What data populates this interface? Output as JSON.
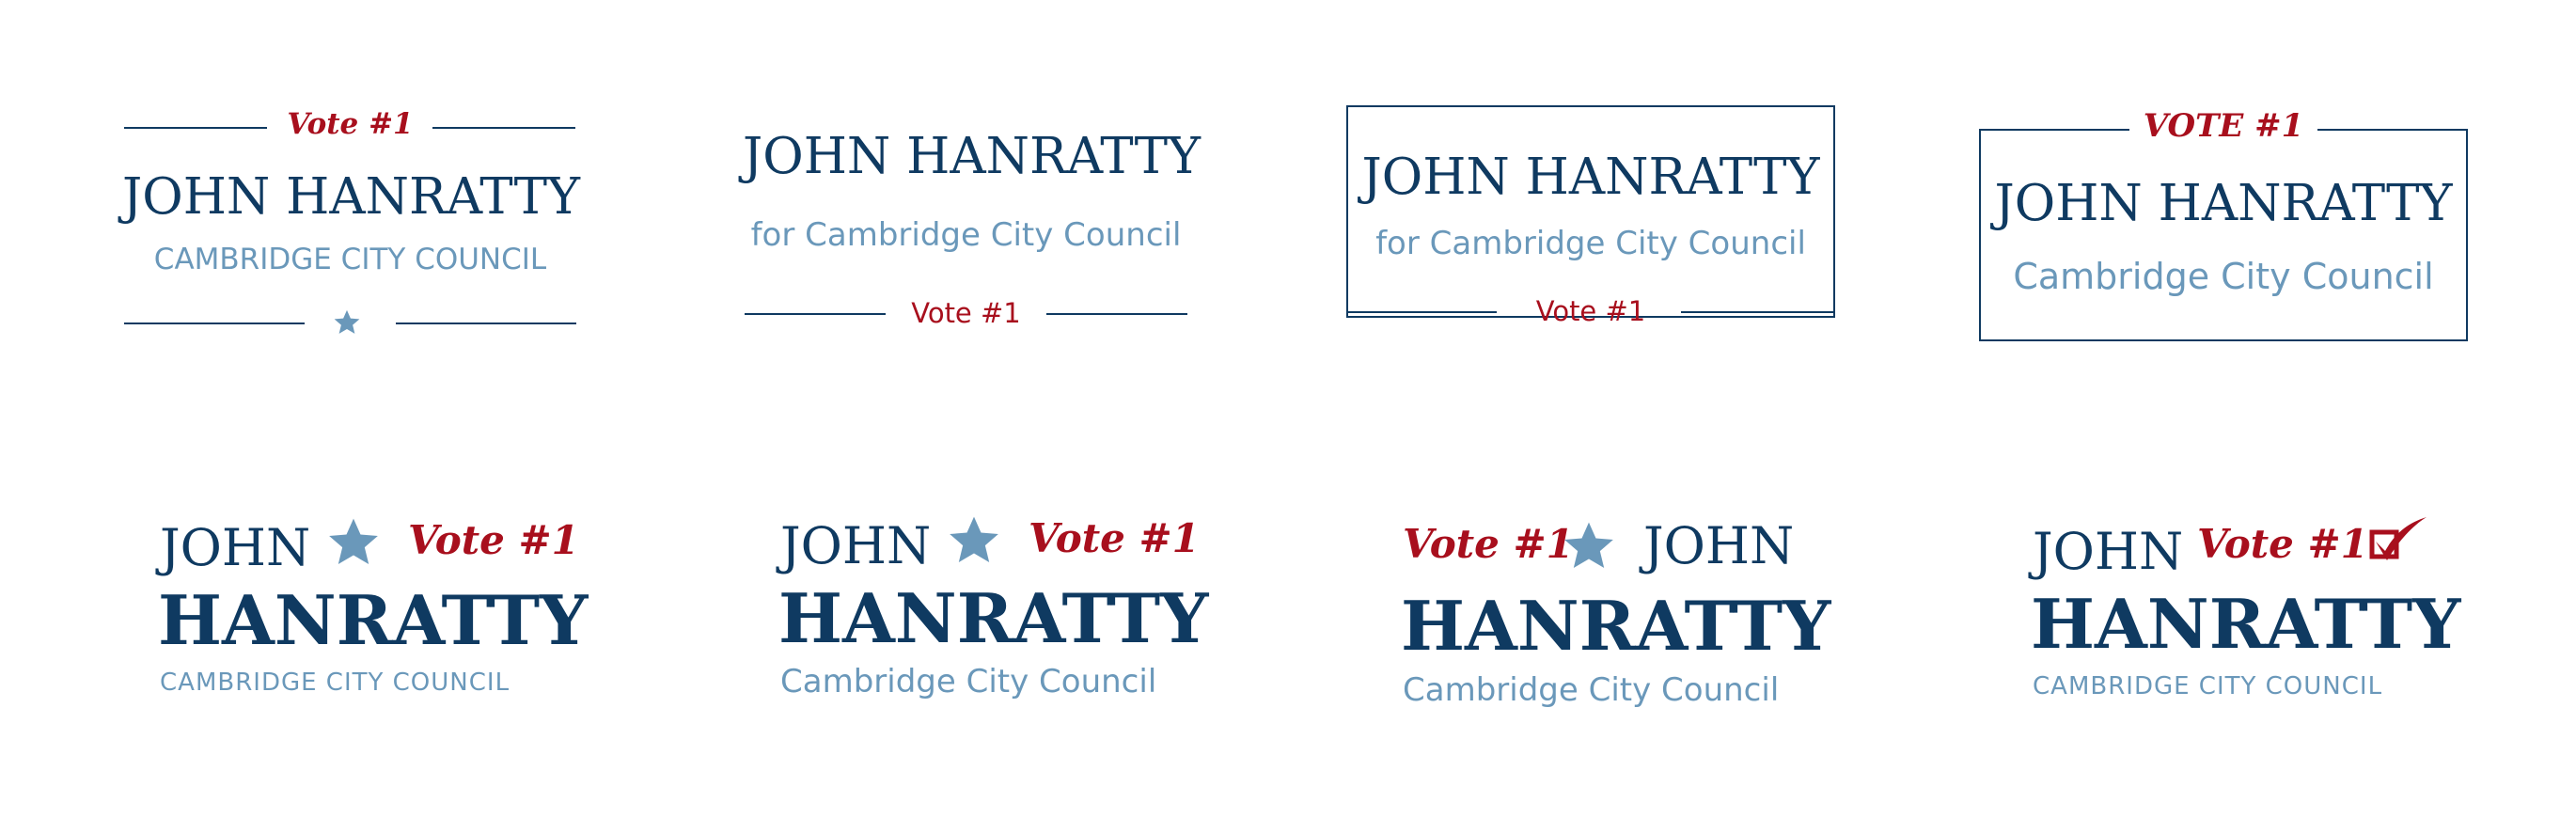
{
  "logos": [
    {
      "name": "John Hanratty",
      "subtitle": "Cambridge City Council",
      "vote": "Vote #1"
    },
    {
      "name": "John Hanratty",
      "subtitle": "for Cambridge City Council",
      "vote": "Vote #1"
    },
    {
      "name": "John Hanratty",
      "subtitle": "for Cambridge City Council",
      "vote": "Vote #1"
    },
    {
      "name": "John Hanratty",
      "subtitle": "Cambridge City Council",
      "vote": "Vote #1"
    },
    {
      "first": "John",
      "last": "Hanratty",
      "subtitle": "Cambridge City Council",
      "vote": "Vote #1"
    },
    {
      "first": "John",
      "last": "Hanratty",
      "subtitle": "Cambridge City Council",
      "vote": "Vote #1"
    },
    {
      "first": "John",
      "last": "Hanratty",
      "subtitle": "Cambridge City Council",
      "vote": "Vote #1"
    },
    {
      "first": "John",
      "last": "Hanratty",
      "subtitle": "Cambridge City Council",
      "vote": "Vote #1"
    }
  ],
  "icons": {
    "star": "star-icon",
    "check": "checkbox-check-icon"
  },
  "colors": {
    "navy": "#0f3a61",
    "light_blue": "#6a98ba",
    "red": "#a80f1d"
  }
}
